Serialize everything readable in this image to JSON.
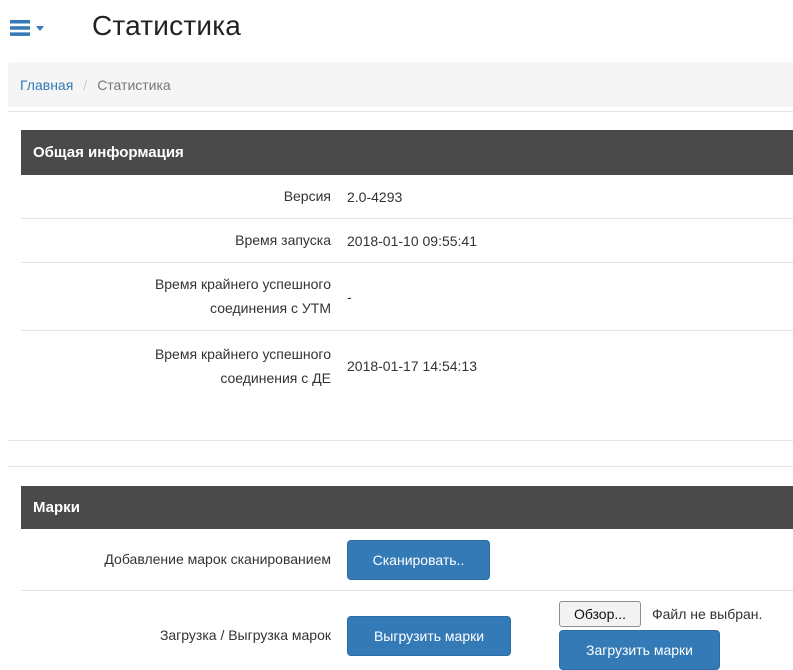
{
  "header": {
    "title": "Статистика"
  },
  "breadcrumb": {
    "home": "Главная",
    "separator": "/",
    "current": "Статистика"
  },
  "general": {
    "heading": "Общая информация",
    "rows": [
      {
        "label": "Версия",
        "value": "2.0-4293"
      },
      {
        "label": "Время запуска",
        "value": "2018-01-10 09:55:41"
      },
      {
        "label_line1": "Время крайнего успешного",
        "label_line2": "соединения с УТМ",
        "value": "-"
      },
      {
        "label_line1": "Время крайнего успешного",
        "label_line2": "соединения с ДЕ",
        "value": "2018-01-17 14:54:13"
      }
    ]
  },
  "marks": {
    "heading": "Марки",
    "scan_label": "Добавление марок сканированием",
    "scan_button": "Сканировать..",
    "transfer_label": "Загрузка / Выгрузка марок",
    "export_button": "Выгрузить марки",
    "browse_button": "Обзор...",
    "file_status": "Файл не выбран.",
    "import_button": "Загрузить марки"
  },
  "colors": {
    "panel_header_bg": "#4a4a4a",
    "primary_button": "#337ab7",
    "link": "#337ab7"
  },
  "icons": {
    "menu": "hamburger-icon",
    "menu_caret": "caret-down-icon"
  }
}
